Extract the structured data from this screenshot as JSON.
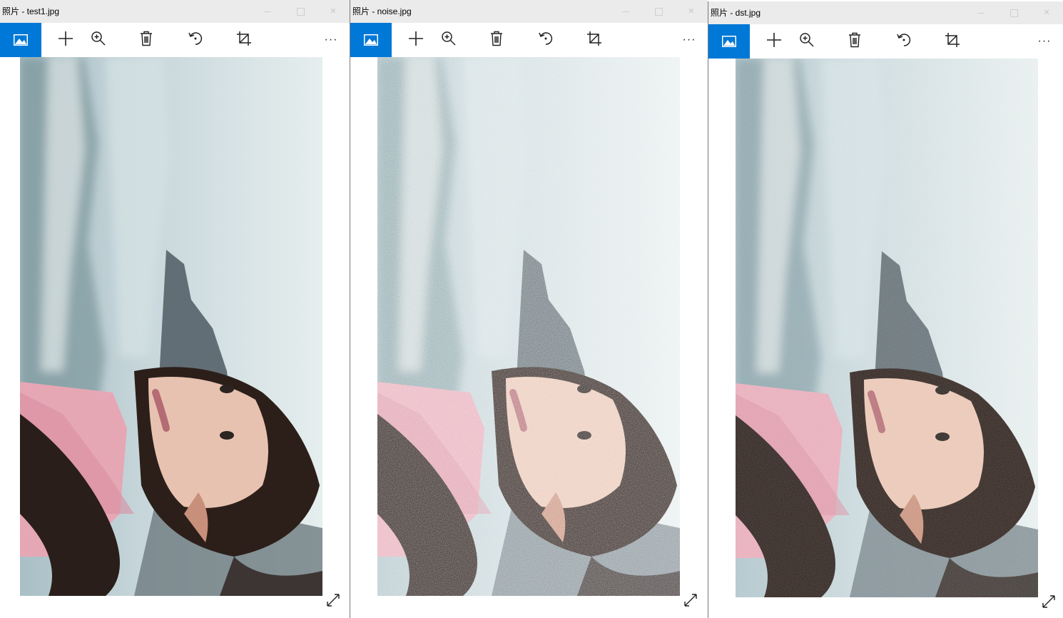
{
  "windows": [
    {
      "title": "照片 - test1.jpg",
      "noise": "none"
    },
    {
      "title": "照片 - noise.jpg",
      "noise": "heavy"
    },
    {
      "title": "照片 - dst.jpg",
      "noise": "light"
    }
  ],
  "toolbar": {
    "more_label": "···",
    "accent_color": "#0078d7"
  },
  "icons": {
    "app": "photos-app-icon",
    "add": "plus-icon",
    "zoom": "zoom-in-icon",
    "delete": "trash-icon",
    "rotate": "rotate-icon",
    "crop": "crop-icon",
    "expand": "expand-icon"
  }
}
